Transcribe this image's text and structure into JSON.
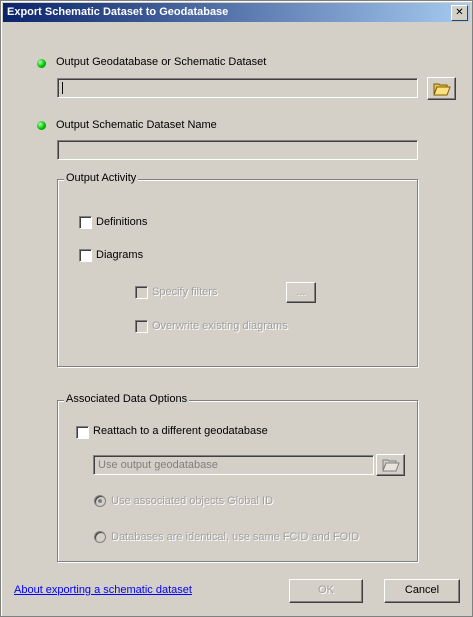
{
  "window": {
    "title": "Export Schematic Dataset to Geodatabase",
    "close_glyph": "✕"
  },
  "output_geodatabase": {
    "label": "Output Geodatabase or Schematic Dataset",
    "value": "",
    "browse_icon": "folder-open-icon"
  },
  "output_dataset_name": {
    "label": "Output Schematic Dataset Name",
    "value": ""
  },
  "output_activity": {
    "title": "Output Activity",
    "definitions": {
      "label": "Definitions",
      "checked": false
    },
    "diagrams": {
      "label": "Diagrams",
      "checked": false
    },
    "specify_filters": {
      "label": "Specify filters",
      "checked": false,
      "enabled": false
    },
    "filters_button_label": "...",
    "overwrite_diagrams": {
      "label": "Overwrite existing diagrams",
      "checked": false,
      "enabled": false
    }
  },
  "associated_data": {
    "title": "Associated Data Options",
    "reattach": {
      "label": "Reattach to a different geodatabase",
      "checked": false
    },
    "geodatabase_value": "Use output geodatabase",
    "browse_icon": "folder-open-icon",
    "radio_global_id": {
      "label": "Use associated objects Global ID",
      "selected": true,
      "enabled": false
    },
    "radio_identical": {
      "label": "Databases are identical, use same FCID and FOID",
      "selected": false,
      "enabled": false
    }
  },
  "footer": {
    "help_link": "About exporting a schematic dataset",
    "ok_label": "OK",
    "cancel_label": "Cancel"
  },
  "colors": {
    "required_indicator": "#00c000",
    "link": "#0000ff",
    "titlebar_start": "#0a246a",
    "titlebar_end": "#a6caf0"
  }
}
